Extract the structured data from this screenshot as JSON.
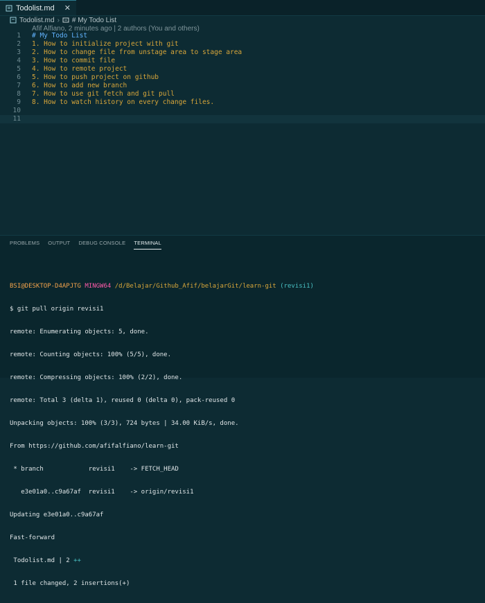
{
  "tab": {
    "label": "Todolist.md",
    "close": "✕"
  },
  "breadcrumb": {
    "file": "Todolist.md",
    "separator": "›",
    "section": "# My Todo List"
  },
  "blame": "Afif Alfiano, 2 minutes ago | 2 authors (You and others)",
  "editor": {
    "lines": [
      {
        "n": "1",
        "text": "# My Todo List"
      },
      {
        "n": "2",
        "text": "1. How to initialize project with git"
      },
      {
        "n": "3",
        "text": "2. How to change file from unstage area to stage area"
      },
      {
        "n": "4",
        "text": "3. How to commit file"
      },
      {
        "n": "5",
        "text": "4. How to remote project"
      },
      {
        "n": "6",
        "text": "5. How to push project on github"
      },
      {
        "n": "7",
        "text": "6. How to add new branch"
      },
      {
        "n": "8",
        "text": "7. How to use git fetch and git pull"
      },
      {
        "n": "9",
        "text": "8. How to watch history on every change files."
      },
      {
        "n": "10",
        "text": ""
      },
      {
        "n": "11",
        "text": ""
      }
    ]
  },
  "panel": {
    "tabs": [
      {
        "label": "PROBLEMS"
      },
      {
        "label": "OUTPUT"
      },
      {
        "label": "DEBUG CONSOLE"
      },
      {
        "label": "TERMINAL"
      }
    ]
  },
  "terminal": {
    "prompt": {
      "user": "BSI@DESKTOP-D4APJTG",
      "shell": "MINGW64",
      "path": "/d/Belajar/Github_Afif/belajarGit/learn-git",
      "branch": "(revisi1)"
    },
    "command": "$ git pull origin revisi1",
    "output": [
      "remote: Enumerating objects: 5, done.",
      "remote: Counting objects: 100% (5/5), done.",
      "remote: Compressing objects: 100% (2/2), done.",
      "remote: Total 3 (delta 1), reused 0 (delta 0), pack-reused 0",
      "Unpacking objects: 100% (3/3), 724 bytes | 34.00 KiB/s, done.",
      "From https://github.com/afifalfiano/learn-git",
      " * branch            revisi1    -> FETCH_HEAD",
      "   e3e01a0..c9a67af  revisi1    -> origin/revisi1",
      "Updating e3e01a0..c9a67af",
      "Fast-forward"
    ],
    "stat_file": " Todolist.md | 2 ",
    "stat_plus": "++",
    "summary": " 1 file changed, 2 insertions(+)"
  }
}
